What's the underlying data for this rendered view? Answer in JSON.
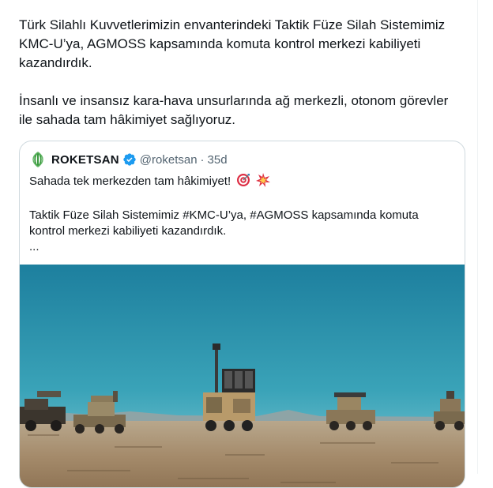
{
  "post": {
    "lines": [
      "Türk Silahlı Kuvvetlerimizin envanterindeki Taktik Füze Silah Sistemimiz KMC-U’ya, AGMOSS kapsamında komuta kontrol merkezi kabiliyeti kazandırdık.",
      "İnsanlı ve insansız kara-hava unsurlarında ağ merkezli, otonom görevler ile sahada tam hâkimiyet sağlıyoruz."
    ]
  },
  "quoted": {
    "author": "ROKETSAN",
    "handle": "@roketsan",
    "separator": "·",
    "ago": "35d",
    "text1": "Sahada tek merkezden tam hâkimiyet!",
    "text2": "Taktik Füze Silah Sistemimiz #KMC-U’ya, #AGMOSS kapsamında komuta kontrol merkezi kabiliyeti kazandırdık.",
    "ellipsis": "...",
    "icons": {
      "logo": "roketsan-logo-icon",
      "verified": "verified-badge-icon",
      "emoji1": "direct-hit-emoji-icon",
      "emoji2": "collision-emoji-icon"
    },
    "colors": {
      "verified": "#1d9bf0",
      "logo_green": "#3a9a3e",
      "sky_top": "#1d7f9e",
      "sky_bottom": "#7ec9d6"
    }
  }
}
